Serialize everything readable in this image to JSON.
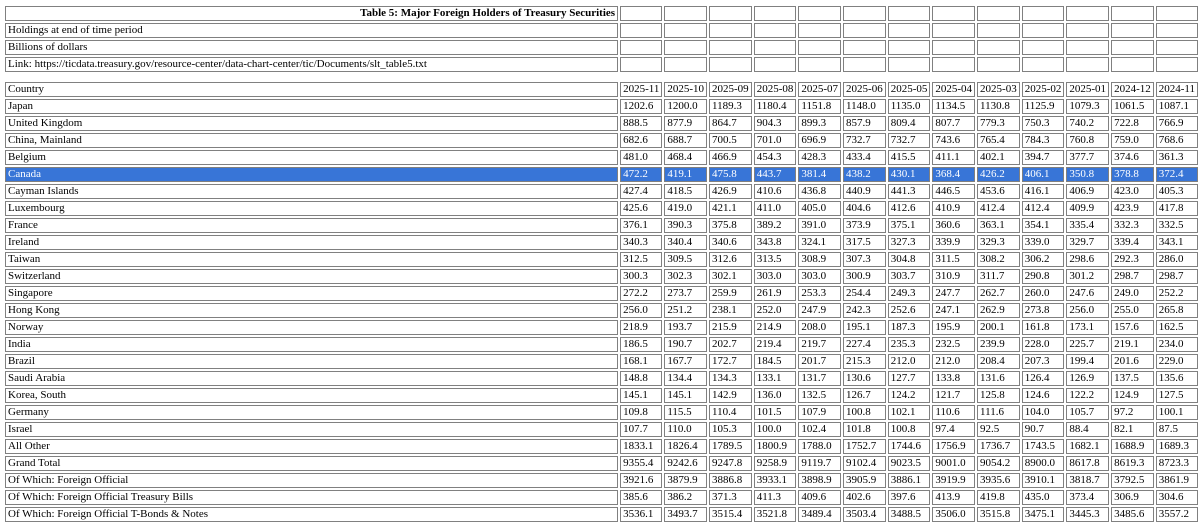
{
  "title": "Table 5: Major Foreign Holders of Treasury Securities",
  "meta": [
    "Holdings at end of time period",
    "Billions of dollars",
    "Link: https://ticdata.treasury.gov/resource-center/data-chart-center/tic/Documents/slt_table5.txt"
  ],
  "header": {
    "label": "Country",
    "columns": [
      "2025-11",
      "2025-10",
      "2025-09",
      "2025-08",
      "2025-07",
      "2025-06",
      "2025-05",
      "2025-04",
      "2025-03",
      "2025-02",
      "2025-01",
      "2024-12",
      "2024-11"
    ]
  },
  "selected_row": 4,
  "rows": [
    {
      "country": "Japan",
      "values": [
        "1202.6",
        "1200.0",
        "1189.3",
        "1180.4",
        "1151.8",
        "1148.0",
        "1135.0",
        "1134.5",
        "1130.8",
        "1125.9",
        "1079.3",
        "1061.5",
        "1087.1"
      ]
    },
    {
      "country": "United Kingdom",
      "values": [
        "888.5",
        "877.9",
        "864.7",
        "904.3",
        "899.3",
        "857.9",
        "809.4",
        "807.7",
        "779.3",
        "750.3",
        "740.2",
        "722.8",
        "766.9"
      ]
    },
    {
      "country": "China, Mainland",
      "values": [
        "682.6",
        "688.7",
        "700.5",
        "701.0",
        "696.9",
        "732.7",
        "732.7",
        "743.6",
        "765.4",
        "784.3",
        "760.8",
        "759.0",
        "768.6"
      ]
    },
    {
      "country": "Belgium",
      "values": [
        "481.0",
        "468.4",
        "466.9",
        "454.3",
        "428.3",
        "433.4",
        "415.5",
        "411.1",
        "402.1",
        "394.7",
        "377.7",
        "374.6",
        "361.3"
      ]
    },
    {
      "country": "Canada",
      "values": [
        "472.2",
        "419.1",
        "475.8",
        "443.7",
        "381.4",
        "438.2",
        "430.1",
        "368.4",
        "426.2",
        "406.1",
        "350.8",
        "378.8",
        "372.4"
      ]
    },
    {
      "country": "Cayman Islands",
      "values": [
        "427.4",
        "418.5",
        "426.9",
        "410.6",
        "436.8",
        "440.9",
        "441.3",
        "446.5",
        "453.6",
        "416.1",
        "406.9",
        "423.0",
        "405.3"
      ]
    },
    {
      "country": "Luxembourg",
      "values": [
        "425.6",
        "419.0",
        "421.1",
        "411.0",
        "405.0",
        "404.6",
        "412.6",
        "410.9",
        "412.4",
        "412.4",
        "409.9",
        "423.9",
        "417.8"
      ]
    },
    {
      "country": "France",
      "values": [
        "376.1",
        "390.3",
        "375.8",
        "389.2",
        "391.0",
        "373.9",
        "375.1",
        "360.6",
        "363.1",
        "354.1",
        "335.4",
        "332.3",
        "332.5"
      ]
    },
    {
      "country": "Ireland",
      "values": [
        "340.3",
        "340.4",
        "340.6",
        "343.8",
        "324.1",
        "317.5",
        "327.3",
        "339.9",
        "329.3",
        "339.0",
        "329.7",
        "339.4",
        "343.1"
      ]
    },
    {
      "country": "Taiwan",
      "values": [
        "312.5",
        "309.5",
        "312.6",
        "313.5",
        "308.9",
        "307.3",
        "304.8",
        "311.5",
        "308.2",
        "306.2",
        "298.6",
        "292.3",
        "286.0"
      ]
    },
    {
      "country": "Switzerland",
      "values": [
        "300.3",
        "302.3",
        "302.1",
        "303.0",
        "303.0",
        "300.9",
        "303.7",
        "310.9",
        "311.7",
        "290.8",
        "301.2",
        "298.7",
        "298.7"
      ]
    },
    {
      "country": "Singapore",
      "values": [
        "272.2",
        "273.7",
        "259.9",
        "261.9",
        "253.3",
        "254.4",
        "249.3",
        "247.7",
        "262.7",
        "260.0",
        "247.6",
        "249.0",
        "252.2"
      ]
    },
    {
      "country": "Hong Kong",
      "values": [
        "256.0",
        "251.2",
        "238.1",
        "252.0",
        "247.9",
        "242.3",
        "252.6",
        "247.1",
        "262.9",
        "273.8",
        "256.0",
        "255.0",
        "265.8"
      ]
    },
    {
      "country": "Norway",
      "values": [
        "218.9",
        "193.7",
        "215.9",
        "214.9",
        "208.0",
        "195.1",
        "187.3",
        "195.9",
        "200.1",
        "161.8",
        "173.1",
        "157.6",
        "162.5"
      ]
    },
    {
      "country": "India",
      "values": [
        "186.5",
        "190.7",
        "202.7",
        "219.4",
        "219.7",
        "227.4",
        "235.3",
        "232.5",
        "239.9",
        "228.0",
        "225.7",
        "219.1",
        "234.0"
      ]
    },
    {
      "country": "Brazil",
      "values": [
        "168.1",
        "167.7",
        "172.7",
        "184.5",
        "201.7",
        "215.3",
        "212.0",
        "212.0",
        "208.4",
        "207.3",
        "199.4",
        "201.6",
        "229.0"
      ]
    },
    {
      "country": "Saudi Arabia",
      "values": [
        "148.8",
        "134.4",
        "134.3",
        "133.1",
        "131.7",
        "130.6",
        "127.7",
        "133.8",
        "131.6",
        "126.4",
        "126.9",
        "137.5",
        "135.6"
      ]
    },
    {
      "country": "Korea, South",
      "values": [
        "145.1",
        "145.1",
        "142.9",
        "136.0",
        "132.5",
        "126.7",
        "124.2",
        "121.7",
        "125.8",
        "124.6",
        "122.2",
        "124.9",
        "127.5"
      ]
    },
    {
      "country": "Germany",
      "values": [
        "109.8",
        "115.5",
        "110.4",
        "101.5",
        "107.9",
        "100.8",
        "102.1",
        "110.6",
        "111.6",
        "104.0",
        "105.7",
        "97.2",
        "100.1"
      ]
    },
    {
      "country": "Israel",
      "values": [
        "107.7",
        "110.0",
        "105.3",
        "100.0",
        "102.4",
        "101.8",
        "100.8",
        "97.4",
        "92.5",
        "90.7",
        "88.4",
        "82.1",
        "87.5"
      ]
    },
    {
      "country": "All Other",
      "values": [
        "1833.1",
        "1826.4",
        "1789.5",
        "1800.9",
        "1788.0",
        "1752.7",
        "1744.6",
        "1756.9",
        "1736.7",
        "1743.5",
        "1682.1",
        "1688.9",
        "1689.3"
      ]
    },
    {
      "country": "Grand Total",
      "values": [
        "9355.4",
        "9242.6",
        "9247.8",
        "9258.9",
        "9119.7",
        "9102.4",
        "9023.5",
        "9001.0",
        "9054.2",
        "8900.0",
        "8617.8",
        "8619.3",
        "8723.3"
      ]
    },
    {
      "country": "Of Which: Foreign Official",
      "values": [
        "3921.6",
        "3879.9",
        "3886.8",
        "3933.1",
        "3898.9",
        "3905.9",
        "3886.1",
        "3919.9",
        "3935.6",
        "3910.1",
        "3818.7",
        "3792.5",
        "3861.9"
      ]
    },
    {
      "country": "Of Which: Foreign Official Treasury Bills",
      "values": [
        "385.6",
        "386.2",
        "371.3",
        "411.3",
        "409.6",
        "402.6",
        "397.6",
        "413.9",
        "419.8",
        "435.0",
        "373.4",
        "306.9",
        "304.6"
      ]
    },
    {
      "country": "Of Which: Foreign Official T-Bonds & Notes",
      "values": [
        "3536.1",
        "3493.7",
        "3515.4",
        "3521.8",
        "3489.4",
        "3503.4",
        "3488.5",
        "3506.0",
        "3515.8",
        "3475.1",
        "3445.3",
        "3485.6",
        "3557.2"
      ]
    }
  ]
}
